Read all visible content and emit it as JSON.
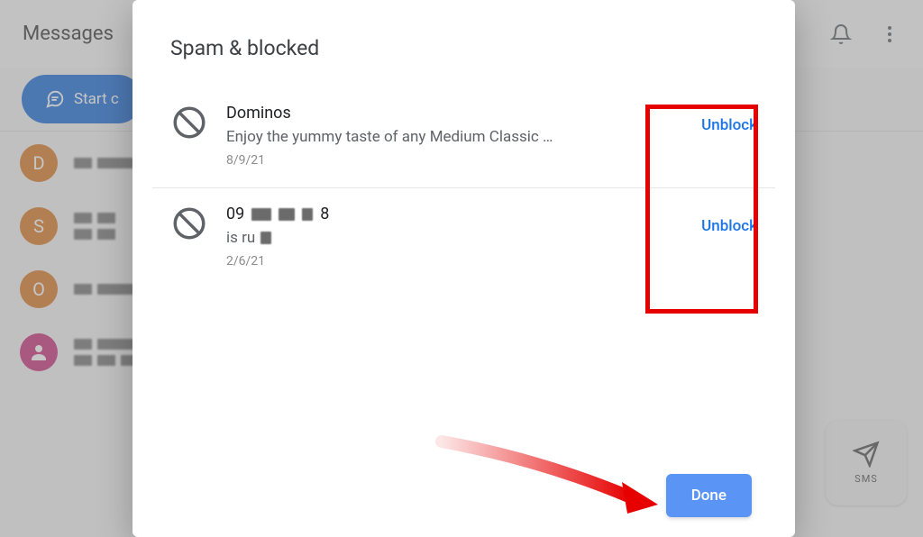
{
  "app": {
    "title": "Messages",
    "start_chat_label": "Start c",
    "sms_label": "SMS"
  },
  "conversations": [
    {
      "initial": "D"
    },
    {
      "initial": "S"
    },
    {
      "initial": "O"
    },
    {
      "initial": ""
    }
  ],
  "dialog": {
    "title": "Spam & blocked",
    "done_label": "Done",
    "items": [
      {
        "name": "Dominos",
        "preview": "Enjoy the yummy taste of any Medium Classic …",
        "date": "8/9/21",
        "action_label": "Unblock"
      },
      {
        "name_prefix": "09",
        "name_suffix": "8",
        "preview_prefix": "is ru",
        "date": "2/6/21",
        "action_label": "Unblock"
      }
    ]
  }
}
